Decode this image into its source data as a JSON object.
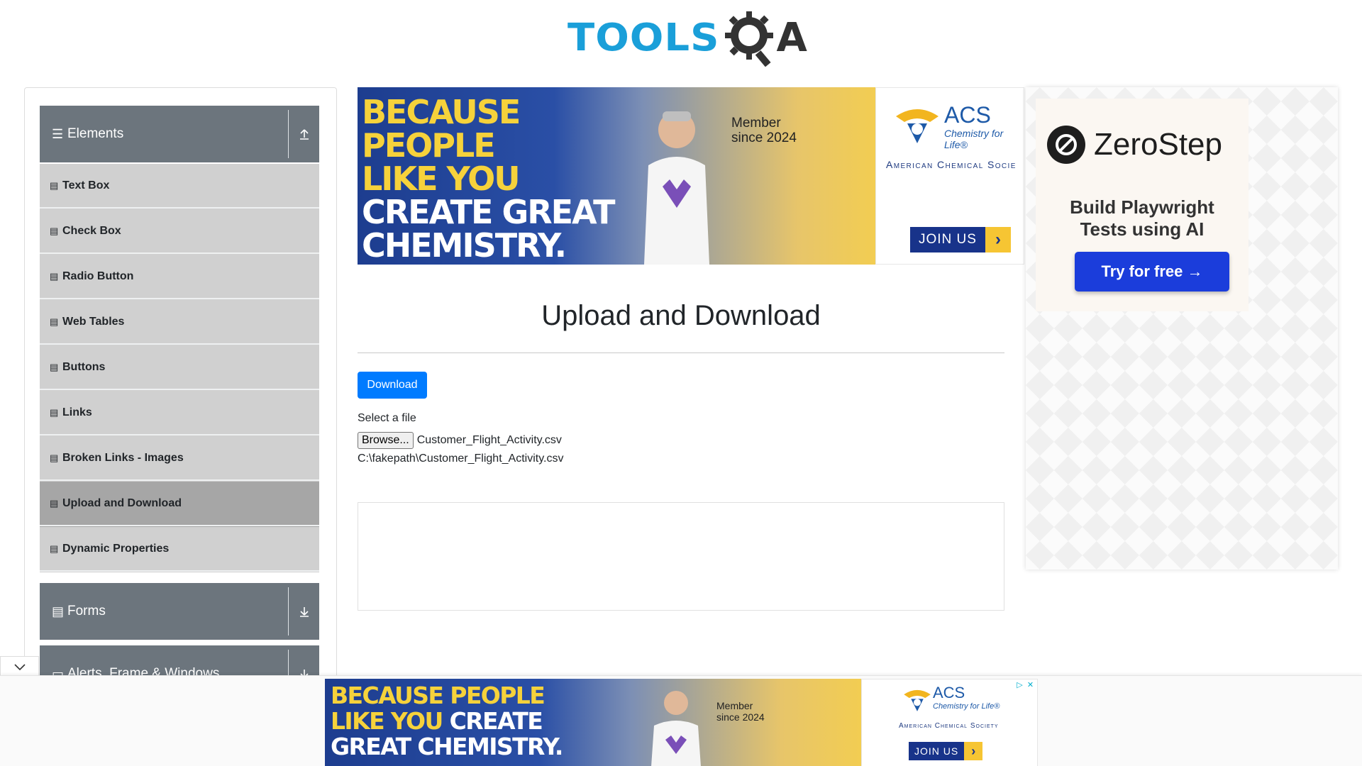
{
  "header": {
    "logo_tools": "TOOLS",
    "logo_q": "Q",
    "logo_a": "A"
  },
  "sidebar": {
    "elements_group": {
      "label": "Elements",
      "icon": "hamburger-icon",
      "toggle_icon": "collapse-up-icon"
    },
    "items": [
      {
        "label": "Text Box"
      },
      {
        "label": "Check Box"
      },
      {
        "label": "Radio Button"
      },
      {
        "label": "Web Tables"
      },
      {
        "label": "Buttons"
      },
      {
        "label": "Links"
      },
      {
        "label": "Broken Links - Images"
      },
      {
        "label": "Upload and Download",
        "active": true
      },
      {
        "label": "Dynamic Properties"
      }
    ],
    "forms_group": {
      "label": "Forms",
      "icon": "form-icon",
      "toggle_icon": "expand-down-icon"
    },
    "alerts_group": {
      "label": "Alerts, Frame & Windows",
      "icon": "window-icon",
      "toggle_icon": "expand-down-icon"
    }
  },
  "ad_top": {
    "headline_yellow": [
      "BECAUSE",
      "PEOPLE",
      "LIKE YOU"
    ],
    "headline_white": [
      "CREATE GREAT",
      "CHEMISTRY."
    ],
    "member": "Member",
    "since": "since 2024",
    "acs_name": "ACS",
    "acs_tagline": "Chemistry for Life®",
    "acs_society": "American Chemical Socie",
    "join_label": "JOIN US"
  },
  "main": {
    "title": "Upload and Download",
    "download_label": "Download",
    "select_label": "Select a file",
    "browse_label": "Browse...",
    "file_name": "Customer_Flight_Activity.csv",
    "file_path": "C:\\fakepath\\Customer_Flight_Activity.csv"
  },
  "ad_right": {
    "brand": "ZeroStep",
    "subtitle_1": "Build Playwright",
    "subtitle_2": "Tests using AI",
    "cta": "Try for free →"
  },
  "ad_bottom": {
    "line1_yellow": "BECAUSE PEOPLE",
    "line2_yellow": "LIKE YOU ",
    "line2_white": "CREATE",
    "line3_white": "GREAT CHEMISTRY.",
    "member": "Member",
    "since": "since 2024",
    "acs_name": "ACS",
    "acs_tagline": "Chemistry for Life®",
    "acs_society": "American Chemical Society",
    "join_label": "JOIN US"
  },
  "colors": {
    "primary_button": "#007bff",
    "sidebar_header": "#6c757d",
    "sidebar_item": "#d0d0d0",
    "sidebar_item_active": "#a6a6a6",
    "logo_blue": "#1a9fd9",
    "zerostep_button": "#1b3ddb"
  }
}
